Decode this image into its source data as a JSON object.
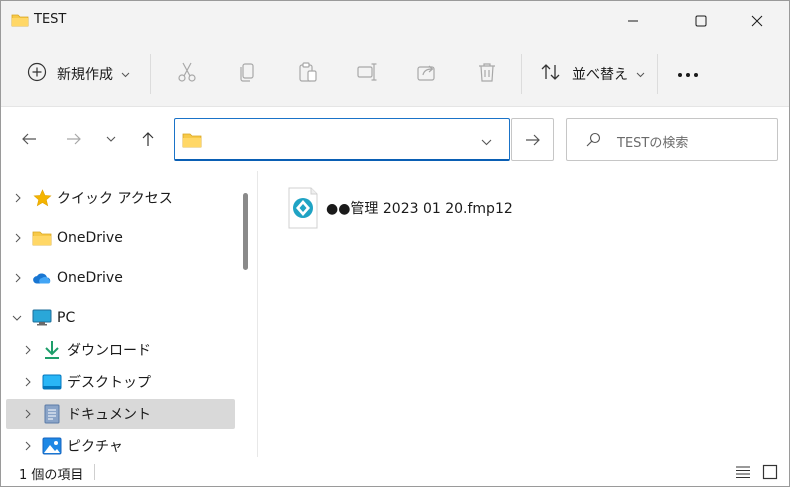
{
  "window": {
    "title": "TEST"
  },
  "toolbar": {
    "new_label": "新規作成",
    "sort_label": "並べ替え"
  },
  "address": {
    "path": ""
  },
  "search": {
    "placeholder": "TESTの検索"
  },
  "sidebar": {
    "items": [
      {
        "label": "クイック アクセス",
        "icon": "star-icon"
      },
      {
        "label": "OneDrive",
        "icon": "folder-icon"
      },
      {
        "label": "OneDrive",
        "icon": "cloud-icon"
      },
      {
        "label": "PC",
        "icon": "monitor-icon"
      },
      {
        "label": "ダウンロード",
        "icon": "download-icon"
      },
      {
        "label": "デスクトップ",
        "icon": "desktop-icon"
      },
      {
        "label": "ドキュメント",
        "icon": "document-icon"
      },
      {
        "label": "ピクチャ",
        "icon": "picture-icon"
      }
    ]
  },
  "files": [
    {
      "name": "●●管理 2023 01 20.fmp12",
      "icon": "filemaker-file-icon"
    }
  ],
  "status": {
    "item_count": "1 個の項目"
  },
  "colors": {
    "accent": "#0a5fb4",
    "folder": "#f7c948",
    "chrome": "#f3f3f3",
    "selected": "#d9d9d9"
  }
}
